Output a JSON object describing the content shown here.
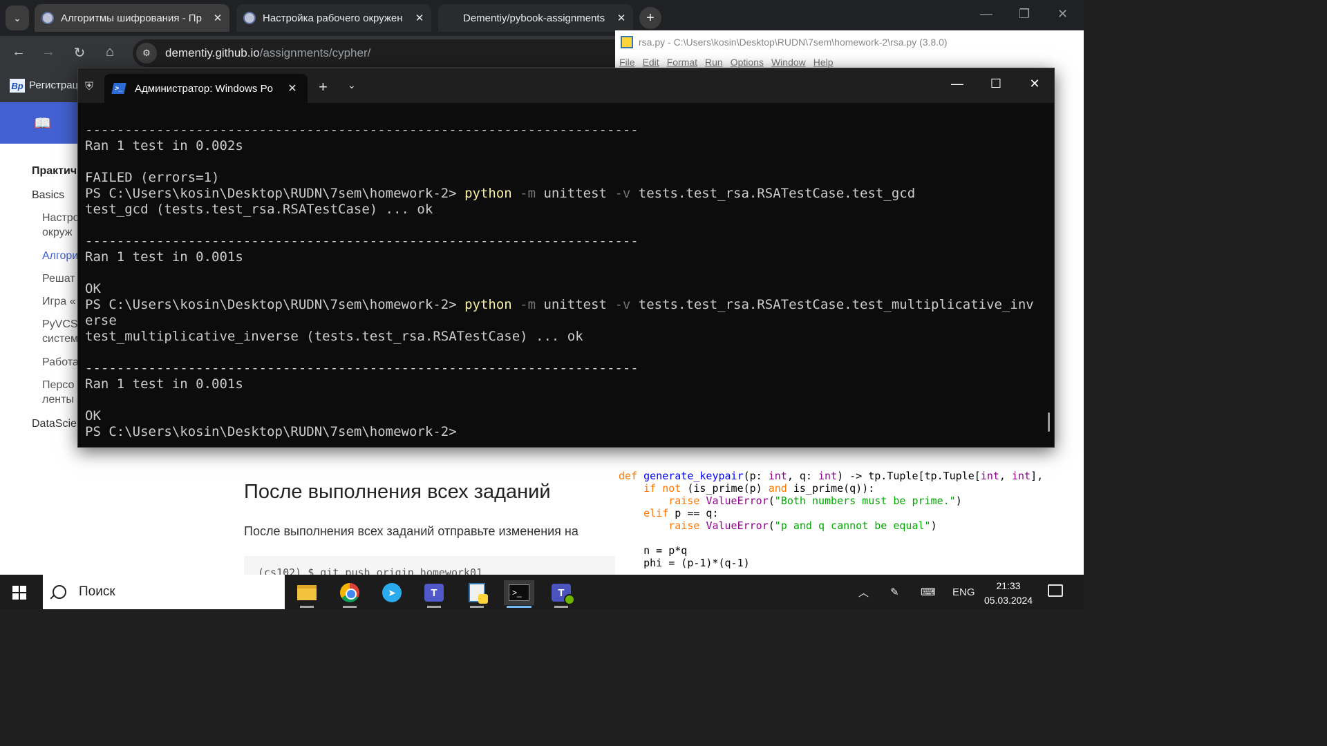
{
  "browser": {
    "tabs": [
      {
        "title": "Алгоритмы шифрования - Пр",
        "active": true
      },
      {
        "title": "Настройка рабочего окружен",
        "active": false
      },
      {
        "title": "Dementiy/pybook-assignments",
        "active": false
      }
    ],
    "url_host": "dementiy.github.io",
    "url_path": "/assignments/cypher/",
    "bookmark_label": "Регистрац",
    "page": {
      "sidebar_title": "Практич",
      "sidebar_items": [
        {
          "label": "Basics",
          "level": "top"
        },
        {
          "label": "Настро",
          "level": "sub"
        },
        {
          "label": "окруж",
          "level": "sub"
        },
        {
          "label": "Алгори",
          "level": "sub",
          "active": true
        },
        {
          "label": "Решат",
          "level": "sub"
        },
        {
          "label": "Игра «",
          "level": "sub"
        },
        {
          "label": "PyVCS",
          "level": "sub"
        },
        {
          "label": "систем",
          "level": "sub"
        },
        {
          "label": "Работа",
          "level": "sub"
        },
        {
          "label": "Персо",
          "level": "sub"
        },
        {
          "label": "ленты",
          "level": "sub"
        },
        {
          "label": "DataScie",
          "level": "top"
        }
      ],
      "heading": "После выполнения всех заданий",
      "paragraph": "После выполнения всех заданий отправьте изменения на",
      "code": "(cs102) $ git push origin homework01"
    }
  },
  "idle": {
    "title": "rsa.py - C:\\Users\\kosin\\Desktop\\RUDN\\7sem\\homework-2\\rsa.py (3.8.0)",
    "menu": [
      "File",
      "Edit",
      "Format",
      "Run",
      "Options",
      "Window",
      "Help"
    ]
  },
  "terminal": {
    "tab_title": "Администратор: Windows Po",
    "lines": [
      {
        "type": "text",
        "text": "----------------------------------------------------------------------"
      },
      {
        "type": "text",
        "text": "Ran 1 test in 0.002s"
      },
      {
        "type": "text",
        "text": ""
      },
      {
        "type": "text",
        "text": "FAILED (errors=1)"
      },
      {
        "type": "cmd",
        "prompt": "PS C:\\Users\\kosin\\Desktop\\RUDN\\7sem\\homework-2> ",
        "cmd": "python",
        "flag1": " -m",
        "arg1": " unittest",
        "flag2": " -v",
        "arg2": " tests.test_rsa.RSATestCase.test_gcd"
      },
      {
        "type": "text",
        "text": "test_gcd (tests.test_rsa.RSATestCase) ... ok"
      },
      {
        "type": "text",
        "text": ""
      },
      {
        "type": "text",
        "text": "----------------------------------------------------------------------"
      },
      {
        "type": "text",
        "text": "Ran 1 test in 0.001s"
      },
      {
        "type": "text",
        "text": ""
      },
      {
        "type": "text",
        "text": "OK"
      },
      {
        "type": "cmd",
        "prompt": "PS C:\\Users\\kosin\\Desktop\\RUDN\\7sem\\homework-2> ",
        "cmd": "python",
        "flag1": " -m",
        "arg1": " unittest",
        "flag2": " -v",
        "arg2": " tests.test_rsa.RSATestCase.test_multiplicative_inv"
      },
      {
        "type": "text",
        "text": "erse"
      },
      {
        "type": "text",
        "text": "test_multiplicative_inverse (tests.test_rsa.RSATestCase) ... ok"
      },
      {
        "type": "text",
        "text": ""
      },
      {
        "type": "text",
        "text": "----------------------------------------------------------------------"
      },
      {
        "type": "text",
        "text": "Ran 1 test in 0.001s"
      },
      {
        "type": "text",
        "text": ""
      },
      {
        "type": "text",
        "text": "OK"
      },
      {
        "type": "text",
        "text": "PS C:\\Users\\kosin\\Desktop\\RUDN\\7sem\\homework-2>"
      }
    ]
  },
  "taskbar": {
    "search_placeholder": "Поиск",
    "apps": [
      "file-explorer-icon",
      "chrome-icon",
      "telegram-icon",
      "teams-icon",
      "python-idle-icon",
      "terminal-icon",
      "teams-classic-icon"
    ],
    "language": "ENG",
    "time": "21:33",
    "date": "05.03.2024"
  },
  "colors": {
    "accent": "#4361d0",
    "terminal_bg": "#0c0c0c",
    "terminal_text": "#cccccc",
    "terminal_command": "#f9f1a5",
    "terminal_flag": "#767676"
  }
}
